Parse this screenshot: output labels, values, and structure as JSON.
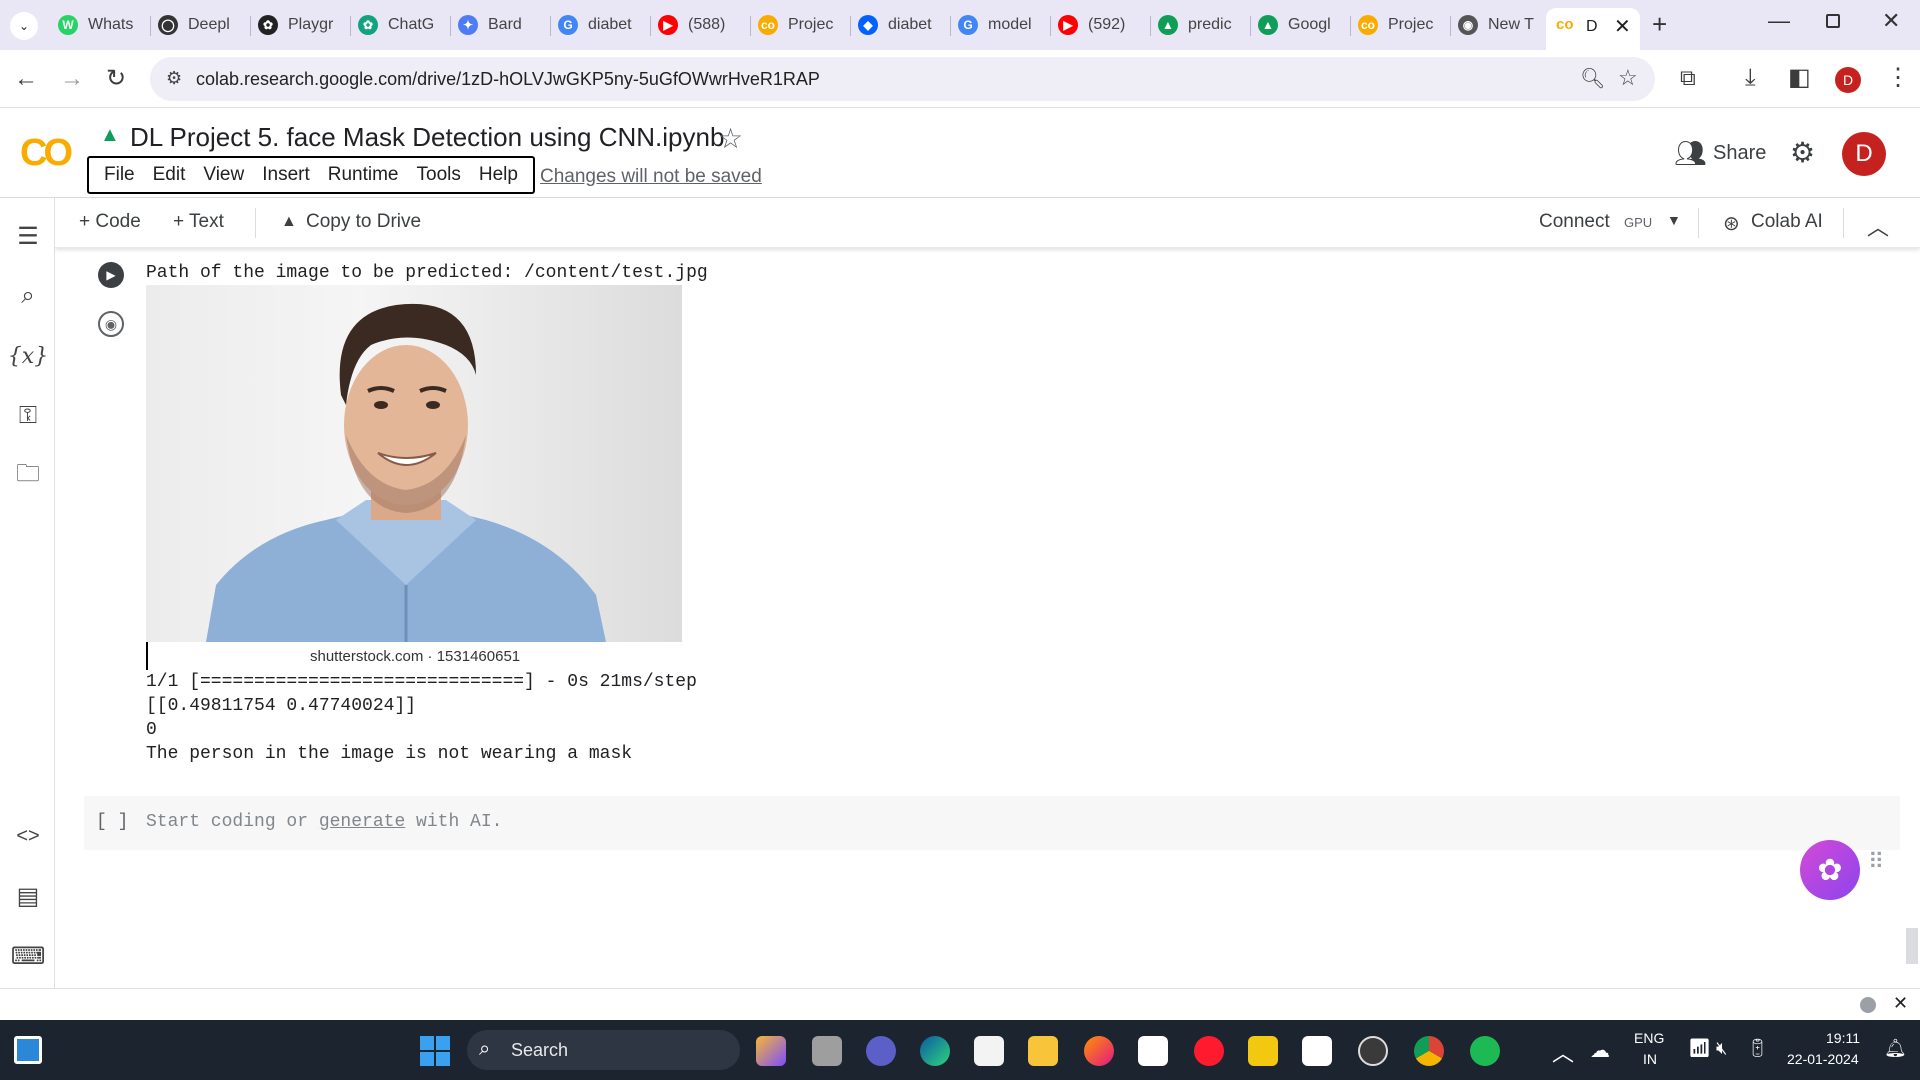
{
  "browser": {
    "tabs": [
      {
        "label": "Whats",
        "color": "#25d366",
        "glyph": "W"
      },
      {
        "label": "Deepl",
        "color": "#333333",
        "glyph": "◯"
      },
      {
        "label": "Playgr",
        "color": "#222222",
        "glyph": "✿"
      },
      {
        "label": "ChatG",
        "color": "#10a37f",
        "glyph": "✿"
      },
      {
        "label": "Bard",
        "color": "#4e7cf6",
        "glyph": "✦"
      },
      {
        "label": "diabet",
        "color": "#4285f4",
        "glyph": "G"
      },
      {
        "label": "(588) ",
        "color": "#ff0000",
        "glyph": "▶"
      },
      {
        "label": "Projec",
        "color": "#f9ab00",
        "glyph": "co"
      },
      {
        "label": "diabet",
        "color": "#0061ff",
        "glyph": "◆"
      },
      {
        "label": "model",
        "color": "#4285f4",
        "glyph": "G"
      },
      {
        "label": "(592) ",
        "color": "#ff0000",
        "glyph": "▶"
      },
      {
        "label": "predic",
        "color": "#0f9d58",
        "glyph": "▲"
      },
      {
        "label": "Googl",
        "color": "#0f9d58",
        "glyph": "▲"
      },
      {
        "label": "Projec",
        "color": "#f9ab00",
        "glyph": "co"
      },
      {
        "label": "New T",
        "color": "#555555",
        "glyph": "◉"
      }
    ],
    "active_tab_label": "D",
    "url": "colab.research.google.com/drive/1zD-hOLVJwGKP5ny-5uGfOWwrHveR1RAP",
    "profile_initial": "D"
  },
  "colab": {
    "notebook_title": "DL Project 5. face Mask Detection using CNN.ipynb",
    "menu": [
      "File",
      "Edit",
      "View",
      "Insert",
      "Runtime",
      "Tools",
      "Help"
    ],
    "unsaved_note": "Changes will not be saved",
    "share_label": "Share",
    "profile_initial": "D",
    "toolbar": {
      "code": "+ Code",
      "text": "+ Text",
      "copy_to_drive": "Copy to Drive",
      "connect": "Connect",
      "gpu": "GPU",
      "colab_ai": "Colab AI"
    },
    "output": {
      "path_line": "Path of the image to be predicted: /content/test.jpg",
      "image_caption": "shutterstock.com · 1531460651",
      "progress_line": "1/1 [==============================] - 0s 21ms/step",
      "prediction_line": "[[0.49811754 0.47740024]]",
      "label_line": "0",
      "result_line": "The person in the image is not wearing a mask"
    },
    "empty_cell": {
      "brackets": "[ ]",
      "placeholder_start": "Start coding or ",
      "placeholder_link": "generate",
      "placeholder_end": " with AI."
    }
  },
  "taskbar": {
    "search_label": "Search",
    "lang_top": "ENG",
    "lang_bottom": "IN",
    "time": "19:11",
    "date": "22-01-2024"
  }
}
